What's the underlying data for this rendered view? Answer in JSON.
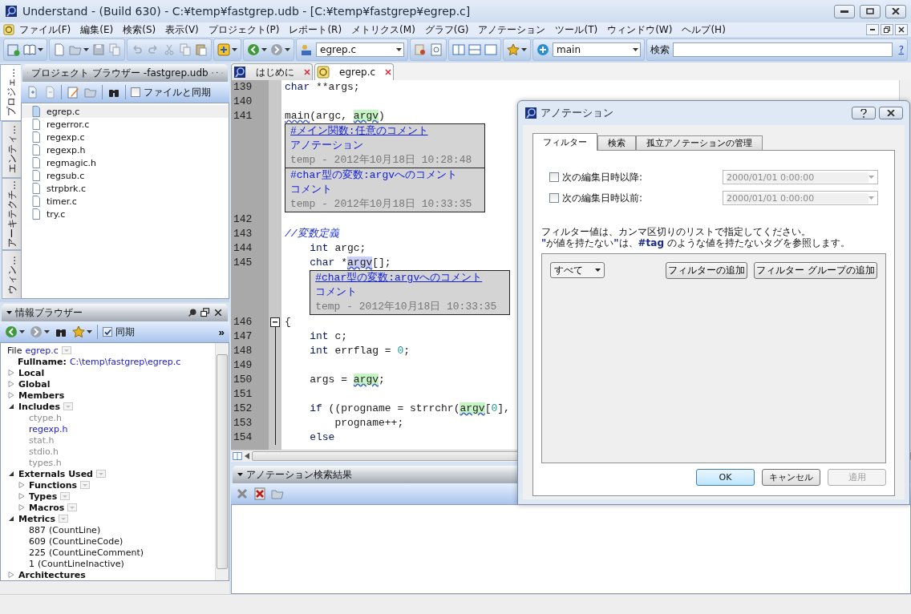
{
  "window": {
    "title": "Understand - (Build 630)  - C:¥temp¥fastgrep.udb - [C:¥temp¥fastgrep¥egrep.c]"
  },
  "menu": [
    "ファイル(F)",
    "編集(E)",
    "検索(S)",
    "表示(V)",
    "プロジェクト(P)",
    "レポート(R)",
    "メトリクス(M)",
    "グラフ(G)",
    "アノテーション",
    "ツール(T)",
    "ウィンドウ(W)",
    "ヘルプ(H)"
  ],
  "toolbar": {
    "file_combo": "egrep.c",
    "scope_combo": "main",
    "search_label": "検索",
    "help_link": "?"
  },
  "side_tabs": [
    {
      "label": "プロジェ...",
      "selected": true
    },
    {
      "label": "エンティ...",
      "selected": false
    },
    {
      "label": "アーキテクチ...",
      "selected": false
    },
    {
      "label": "ウィン...",
      "selected": false
    }
  ],
  "project_browser": {
    "title": "プロジェクト ブラウザー -fastgrep.udb",
    "sync": {
      "label": "ファイルと同期",
      "checked": false
    },
    "files": [
      {
        "name": "egrep.c",
        "selected": true
      },
      {
        "name": "regerror.c",
        "selected": false
      },
      {
        "name": "regexp.c",
        "selected": false
      },
      {
        "name": "regexp.h",
        "selected": false
      },
      {
        "name": "regmagic.h",
        "selected": false
      },
      {
        "name": "regsub.c",
        "selected": false
      },
      {
        "name": "strpbrk.c",
        "selected": false
      },
      {
        "name": "timer.c",
        "selected": false
      },
      {
        "name": "try.c",
        "selected": false
      }
    ]
  },
  "info_browser": {
    "title": "情報ブラウザー",
    "sync": {
      "label": "同期",
      "checked": true
    },
    "more": "»",
    "items": [
      {
        "kind": "entity",
        "label": "File",
        "value": "egrep.c",
        "children": [
          {
            "kind": "field",
            "label": "Fullname:",
            "value": "C:\\temp\\fastgrep\\egrep.c"
          }
        ]
      },
      {
        "kind": "group",
        "label": "Local",
        "expanded": false
      },
      {
        "kind": "group",
        "label": "Global",
        "expanded": false
      },
      {
        "kind": "group",
        "label": "Members",
        "expanded": false
      },
      {
        "kind": "group",
        "label": "Includes",
        "expanded": true,
        "menu": true,
        "children": [
          {
            "kind": "include",
            "text": "ctype.h",
            "resolved": false
          },
          {
            "kind": "include",
            "text": "regexp.h",
            "resolved": true
          },
          {
            "kind": "include",
            "text": "stat.h",
            "resolved": false
          },
          {
            "kind": "include",
            "text": "stdio.h",
            "resolved": false
          },
          {
            "kind": "include",
            "text": "types.h",
            "resolved": false
          }
        ]
      },
      {
        "kind": "group",
        "label": "Externals Used",
        "expanded": true,
        "menu": true,
        "children": [
          {
            "kind": "group",
            "label": "Functions",
            "expanded": false,
            "menu": true
          },
          {
            "kind": "group",
            "label": "Types",
            "expanded": false,
            "menu": true
          },
          {
            "kind": "group",
            "label": "Macros",
            "expanded": false,
            "menu": true
          }
        ]
      },
      {
        "kind": "group",
        "label": "Metrics",
        "expanded": true,
        "menu": true,
        "children": [
          {
            "kind": "metric",
            "count": "887",
            "name": "(CountLine)"
          },
          {
            "kind": "metric",
            "count": "609",
            "name": "(CountLineCode)"
          },
          {
            "kind": "metric",
            "count": "225",
            "name": "(CountLineComment)"
          },
          {
            "kind": "metric",
            "count": "1",
            "name": "(CountLineInactive)"
          }
        ]
      },
      {
        "kind": "group",
        "label": "Architectures",
        "expanded": false
      }
    ]
  },
  "editor_tabs": [
    {
      "label": "はじめに",
      "selected": false
    },
    {
      "label": "egrep.c",
      "selected": true
    }
  ],
  "code": [
    {
      "number": "139",
      "tokens": [
        {
          "t": "char",
          "kind": "keyword"
        },
        {
          "t": " **args;",
          "kind": "plain"
        }
      ]
    },
    {
      "number": "140"
    },
    {
      "number": "141",
      "tokens": [
        {
          "t": "main",
          "kind": "ref"
        },
        {
          "t": "(argc, ",
          "kind": "plain"
        },
        {
          "t": "argv",
          "kind": "match"
        },
        {
          "t": ")",
          "kind": "plain"
        }
      ],
      "annotations": [
        {
          "title": "#メイン関数:任意のコメント",
          "underlined": true,
          "body": "アノテーション",
          "meta": "temp - 2012年10月18日 10:28:48"
        },
        {
          "title": "#char型の変数:argvへのコメント",
          "underlined": false,
          "body": "コメント",
          "meta": "temp - 2012年10月18日 10:33:35"
        }
      ]
    },
    {
      "number": "142"
    },
    {
      "number": "143",
      "tokens": [
        {
          "t": "//変数定義",
          "kind": "comment"
        }
      ]
    },
    {
      "number": "144",
      "tokens": [
        {
          "t": "    int",
          "kind": "keyword"
        },
        {
          "t": " argc;",
          "kind": "plain"
        }
      ]
    },
    {
      "number": "145",
      "tokens": [
        {
          "t": "    char",
          "kind": "keyword"
        },
        {
          "t": " *",
          "kind": "plain"
        },
        {
          "t": "argv",
          "kind": "current"
        },
        {
          "t": "[];",
          "kind": "plain"
        }
      ],
      "annotations": [
        {
          "title": "#char型の変数:argvへのコメント",
          "underlined": true,
          "body": "コメント",
          "meta": "temp - 2012年10月18日 10:33:35"
        }
      ]
    },
    {
      "number": "146",
      "fold_start": true,
      "tokens": [
        {
          "t": "{",
          "kind": "plain"
        }
      ]
    },
    {
      "number": "147",
      "in_fold": true,
      "tokens": [
        {
          "t": "    int",
          "kind": "keyword"
        },
        {
          "t": " c;",
          "kind": "plain"
        }
      ]
    },
    {
      "number": "148",
      "in_fold": true,
      "tokens": [
        {
          "t": "    int",
          "kind": "keyword"
        },
        {
          "t": " errflag = ",
          "kind": "plain"
        },
        {
          "t": "0",
          "kind": "number"
        },
        {
          "t": ";",
          "kind": "plain"
        }
      ]
    },
    {
      "number": "149",
      "in_fold": true
    },
    {
      "number": "150",
      "in_fold": true,
      "tokens": [
        {
          "t": "    args = ",
          "kind": "plain"
        },
        {
          "t": "argv",
          "kind": "match"
        },
        {
          "t": ";",
          "kind": "plain"
        }
      ]
    },
    {
      "number": "151",
      "in_fold": true
    },
    {
      "number": "152",
      "in_fold": true,
      "tokens": [
        {
          "t": "    if",
          "kind": "keyword"
        },
        {
          "t": " ((progname = strrchr(",
          "kind": "plain"
        },
        {
          "t": "argv",
          "kind": "match"
        },
        {
          "t": "[",
          "kind": "plain"
        },
        {
          "t": "0",
          "kind": "number"
        },
        {
          "t": "],",
          "kind": "plain"
        }
      ]
    },
    {
      "number": "153",
      "in_fold": true,
      "tokens": [
        {
          "t": "        progname++;",
          "kind": "plain"
        }
      ]
    },
    {
      "number": "154",
      "in_fold": true,
      "tokens": [
        {
          "t": "    else",
          "kind": "keyword"
        }
      ]
    }
  ],
  "results_panel": {
    "title": "アノテーション検索結果"
  },
  "dialog": {
    "title": "アノテーション",
    "tabs": [
      {
        "label": "フィルター",
        "selected": true
      },
      {
        "label": "検索",
        "selected": false
      },
      {
        "label": "孤立アノテーションの管理",
        "selected": false
      }
    ],
    "date_filters": [
      {
        "label": "次の編集日時以降:",
        "checked": false,
        "value": "2000/01/01 0:00:00"
      },
      {
        "label": "次の編集日時以前:",
        "checked": false,
        "value": "2000/01/01 0:00:00"
      }
    ],
    "notes": [
      [
        {
          "text": "フィルター値は、カンマ区切りのリストで指定してください。",
          "emphasis": false
        }
      ],
      [
        {
          "text": "\"",
          "emphasis": true
        },
        {
          "text": "が値を持たない",
          "emphasis": false
        },
        {
          "text": "\"",
          "emphasis": true
        },
        {
          "text": "は、",
          "emphasis": false
        },
        {
          "text": "#tag",
          "emphasis": true
        },
        {
          "text": " のような値を持たないタグを参照します。",
          "emphasis": false
        }
      ]
    ],
    "match_combo": "すべて",
    "filter_buttons": [
      "フィルターの追加",
      "フィルター グループの追加"
    ],
    "buttons": [
      {
        "label": "OK",
        "kind": "default",
        "disabled": false
      },
      {
        "label": "キャンセル",
        "kind": "normal",
        "disabled": false
      },
      {
        "label": "適用",
        "kind": "normal",
        "disabled": true
      }
    ]
  }
}
